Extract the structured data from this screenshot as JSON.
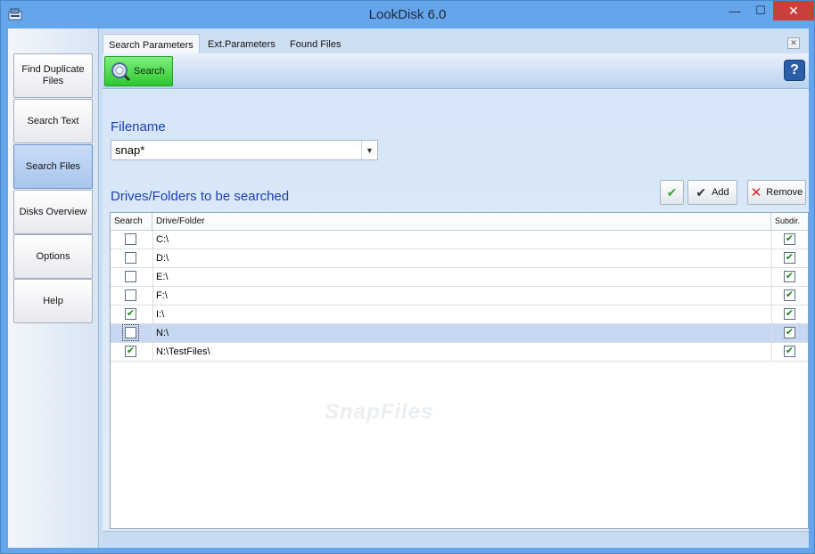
{
  "window": {
    "title": "LookDisk 6.0",
    "minimize_glyph": "—",
    "maximize_glyph": "☐",
    "close_glyph": "✕"
  },
  "sidebar": {
    "items": [
      {
        "label": "Find Duplicate Files",
        "active": false
      },
      {
        "label": "Search Text",
        "active": false
      },
      {
        "label": "Search Files",
        "active": true
      },
      {
        "label": "Disks Overview",
        "active": false
      },
      {
        "label": "Options",
        "active": false
      },
      {
        "label": "Help",
        "active": false
      }
    ]
  },
  "tabs": [
    {
      "label": "Search Parameters",
      "active": true
    },
    {
      "label": "Ext.Parameters",
      "active": false
    },
    {
      "label": "Found Files",
      "active": false
    }
  ],
  "toolbar": {
    "search_label": "Search",
    "help_label": "?"
  },
  "form": {
    "filename_label": "Filename",
    "filename_value": "snap*",
    "drives_label": "Drives/Folders to be searched",
    "add_label": "Add",
    "remove_label": "Remove"
  },
  "grid": {
    "columns": [
      "Search",
      "Drive/Folder",
      "Subdir."
    ],
    "rows": [
      {
        "search": false,
        "path": "C:\\",
        "subdir": true,
        "selected": false
      },
      {
        "search": false,
        "path": "D:\\",
        "subdir": true,
        "selected": false
      },
      {
        "search": false,
        "path": "E:\\",
        "subdir": true,
        "selected": false
      },
      {
        "search": false,
        "path": "F:\\",
        "subdir": true,
        "selected": false
      },
      {
        "search": true,
        "path": "I:\\",
        "subdir": true,
        "selected": false
      },
      {
        "search": false,
        "path": "N:\\",
        "subdir": true,
        "selected": true
      },
      {
        "search": true,
        "path": "N:\\TestFiles\\",
        "subdir": true,
        "selected": false
      }
    ]
  },
  "watermark": "SnapFiles",
  "colors": {
    "accent": "#1c3fb0",
    "search_button": "#2fc72f",
    "check": "#1e8a1e",
    "close": "#c7413a"
  }
}
